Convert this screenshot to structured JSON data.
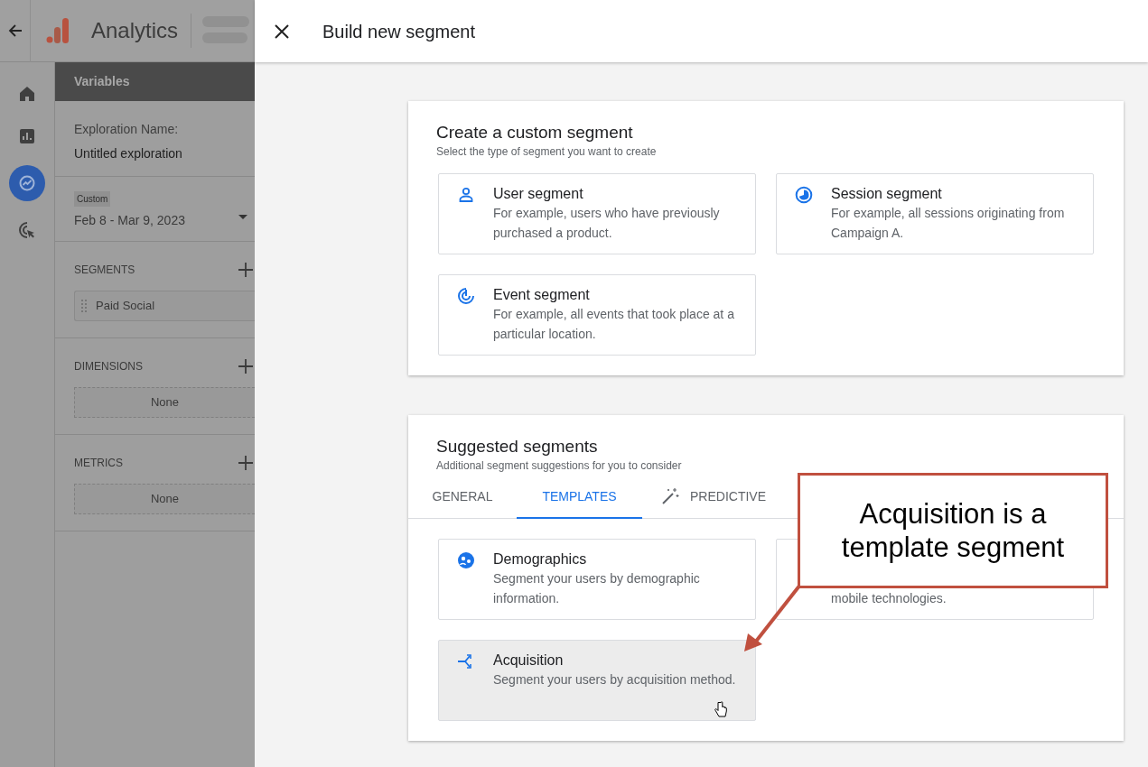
{
  "app": {
    "title": "Analytics"
  },
  "nav": [
    {
      "selected": false
    },
    {
      "selected": false
    },
    {
      "selected": true
    },
    {
      "selected": false
    }
  ],
  "variables": {
    "title": "Variables",
    "exploration_label": "Exploration Name:",
    "exploration_name": "Untitled exploration",
    "date_chip": "Custom",
    "date_range": "Feb 8 - Mar 9, 2023",
    "sections": [
      {
        "title": "SEGMENTS",
        "items": [
          "Paid Social"
        ]
      },
      {
        "title": "DIMENSIONS",
        "empty": "None"
      },
      {
        "title": "METRICS",
        "empty": "None"
      }
    ]
  },
  "dialog": {
    "title": "Build new segment",
    "custom": {
      "title": "Create a custom segment",
      "subtitle": "Select the type of segment you want to create",
      "options": [
        {
          "title": "User segment",
          "description": "For example, users who have previously purchased a product."
        },
        {
          "title": "Session segment",
          "description": "For example, all sessions originating from Campaign A."
        },
        {
          "title": "Event segment",
          "description": "For example, all events that took place at a particular location."
        }
      ]
    },
    "suggested": {
      "title": "Suggested segments",
      "subtitle": "Additional segment suggestions for you to consider",
      "tabs": [
        {
          "label": "GENERAL",
          "selected": false
        },
        {
          "label": "TEMPLATES",
          "selected": true
        },
        {
          "label": "PREDICTIVE",
          "selected": false
        }
      ],
      "options": [
        {
          "title": "Demographics",
          "description": "Segment your users by demographic information.",
          "hovered": false
        },
        {
          "description": "mobile technologies.",
          "hovered": false
        },
        {
          "title": "Acquisition",
          "description": "Segment your users by acquisition method.",
          "hovered": true
        }
      ]
    }
  },
  "callout": {
    "text": "Acquisition is a template segment"
  }
}
